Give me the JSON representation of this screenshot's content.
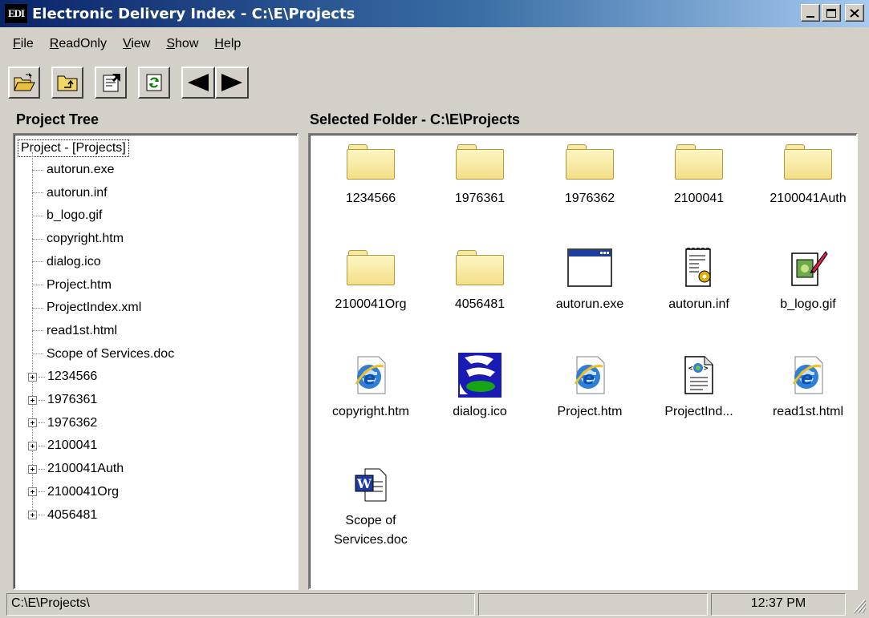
{
  "window": {
    "app_icon_text": "EDI",
    "title": "Electronic Delivery Index - C:\\E\\Projects"
  },
  "menu": [
    {
      "label": "File"
    },
    {
      "label": "ReadOnly"
    },
    {
      "label": "View"
    },
    {
      "label": "Show"
    },
    {
      "label": "Help"
    }
  ],
  "toolbar": {
    "icons": [
      "open-folder-icon",
      "up-folder-icon",
      "properties-icon",
      "refresh-icon",
      "back-arrow-icon",
      "forward-arrow-icon"
    ]
  },
  "tree": {
    "title": "Project Tree",
    "root": "Project - [Projects]",
    "files": [
      "autorun.exe",
      "autorun.inf",
      "b_logo.gif",
      "copyright.htm",
      "dialog.ico",
      "Project.htm",
      "ProjectIndex.xml",
      "read1st.html",
      "Scope of Services.doc"
    ],
    "folders": [
      "1234566",
      "1976361",
      "1976362",
      "2100041",
      "2100041Auth",
      "2100041Org",
      "4056481"
    ]
  },
  "folder_view": {
    "title": "Selected Folder - C:\\E\\Projects",
    "items": [
      {
        "label": "1234566",
        "icon": "folder-icon"
      },
      {
        "label": "1976361",
        "icon": "folder-icon"
      },
      {
        "label": "1976362",
        "icon": "folder-icon"
      },
      {
        "label": "2100041",
        "icon": "folder-icon"
      },
      {
        "label": "2100041Auth",
        "icon": "folder-icon"
      },
      {
        "label": "2100041Org",
        "icon": "folder-icon"
      },
      {
        "label": "4056481",
        "icon": "folder-icon"
      },
      {
        "label": "autorun.exe",
        "icon": "application-window-icon"
      },
      {
        "label": "autorun.inf",
        "icon": "settings-file-icon"
      },
      {
        "label": "b_logo.gif",
        "icon": "image-file-icon"
      },
      {
        "label": "copyright.htm",
        "icon": "internet-explorer-icon"
      },
      {
        "label": "dialog.ico",
        "icon": "dialog-ico-icon"
      },
      {
        "label": "Project.htm",
        "icon": "internet-explorer-icon"
      },
      {
        "label": "ProjectInd...",
        "icon": "xml-file-icon"
      },
      {
        "label": "read1st.html",
        "icon": "internet-explorer-icon"
      },
      {
        "label": "Scope of Services.doc",
        "icon": "word-document-icon"
      }
    ]
  },
  "status": {
    "path": "C:\\E\\Projects\\",
    "middle": "",
    "time": "12:37 PM"
  }
}
